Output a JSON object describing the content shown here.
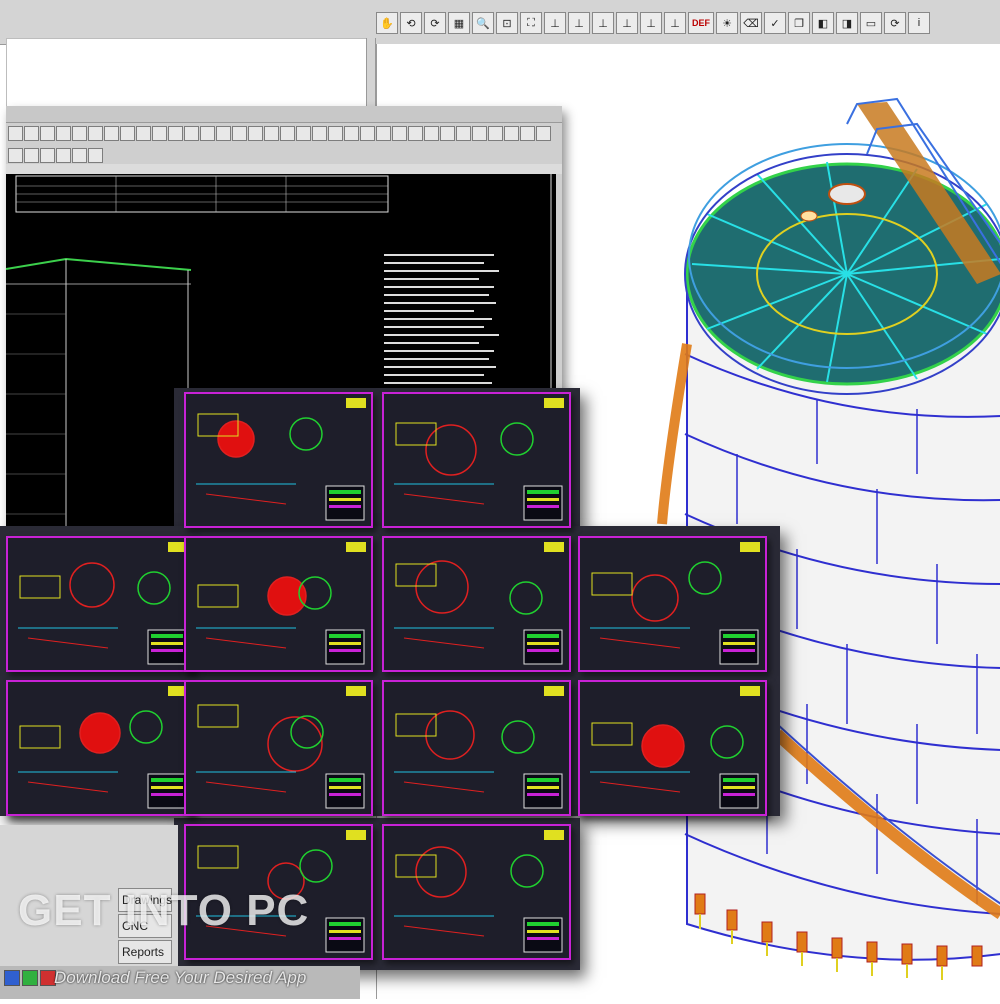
{
  "toolbar_3d": {
    "buttons": [
      {
        "name": "hand-pan-icon",
        "glyph": "✋"
      },
      {
        "name": "rotate-icon",
        "glyph": "⟲"
      },
      {
        "name": "rotate-alt-icon",
        "glyph": "⟳"
      },
      {
        "name": "grid-icon",
        "glyph": "▦"
      },
      {
        "name": "zoom-in-icon",
        "glyph": "🔍"
      },
      {
        "name": "zoom-window-icon",
        "glyph": "⊡"
      },
      {
        "name": "zoom-extents-icon",
        "glyph": "⛶"
      },
      {
        "name": "view-xy-icon",
        "glyph": "⊥"
      },
      {
        "name": "view-yx-icon",
        "glyph": "⊥"
      },
      {
        "name": "view-xz-icon",
        "glyph": "⊥"
      },
      {
        "name": "view-zx-icon",
        "glyph": "⊥"
      },
      {
        "name": "view-iso-icon",
        "glyph": "⊥"
      },
      {
        "name": "view-custom-icon",
        "glyph": "⊥"
      },
      {
        "name": "deformed-icon",
        "glyph": "DEF"
      },
      {
        "name": "light-icon",
        "glyph": "☀"
      },
      {
        "name": "eraser-icon",
        "glyph": "⌫"
      },
      {
        "name": "check-icon",
        "glyph": "✓"
      },
      {
        "name": "copy-icon",
        "glyph": "❐"
      },
      {
        "name": "panel-icon",
        "glyph": "◧"
      },
      {
        "name": "split-view-icon",
        "glyph": "◨"
      },
      {
        "name": "screen-icon",
        "glyph": "▭"
      },
      {
        "name": "refresh-icon",
        "glyph": "⟳"
      },
      {
        "name": "info-icon",
        "glyph": "i"
      }
    ]
  },
  "side_menu": {
    "items": [
      "Drawings",
      "CNC",
      "Reports"
    ]
  },
  "watermark": {
    "text": "GET INTO PC",
    "tagline": "Download Free Your Desired App"
  },
  "colors": {
    "sheet_border": "#c822d6",
    "tank_deck": "#1f6d70",
    "tank_shell": "#f2f2f2",
    "stair": "#e07b16"
  }
}
